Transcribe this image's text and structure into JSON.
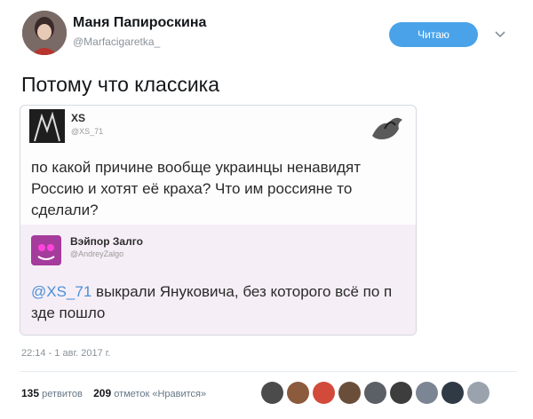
{
  "author": {
    "name": "Маня Папироскина",
    "handle": "@Marfacigaretka_"
  },
  "follow": {
    "label": "Читаю"
  },
  "tweet": {
    "text": "Потому что классика"
  },
  "quoted": {
    "author_name": "XS",
    "author_handle": "@XS_71",
    "text": "по какой причине вообще украинцы ненавидят Россию и хотят её краха? Что им россияне то сделали?",
    "reply": {
      "author_name": "Вэйпор Залго",
      "author_handle": "@AndreyZalgo",
      "mention": "@XS_71",
      "text": "выкрали Януковича, без которого всё по п  здe пошло"
    }
  },
  "meta": {
    "timestamp": "22:14 - 1 авг. 2017 г."
  },
  "stats": {
    "retweets_count": "135",
    "retweets_label": "ретвитов",
    "likes_count": "209",
    "likes_label": "отметок «Нравится»"
  },
  "likers": [
    "#4b4b4b",
    "#8c5a3c",
    "#d24a3a",
    "#6a4e3a",
    "#5b5f66",
    "#3d3d3d",
    "#7c8593",
    "#2f3a45",
    "#9aa3ad"
  ],
  "colors": {
    "accent": "#4aa3e9",
    "mention": "#4a90d9",
    "reply_bg": "#f6eef6"
  }
}
